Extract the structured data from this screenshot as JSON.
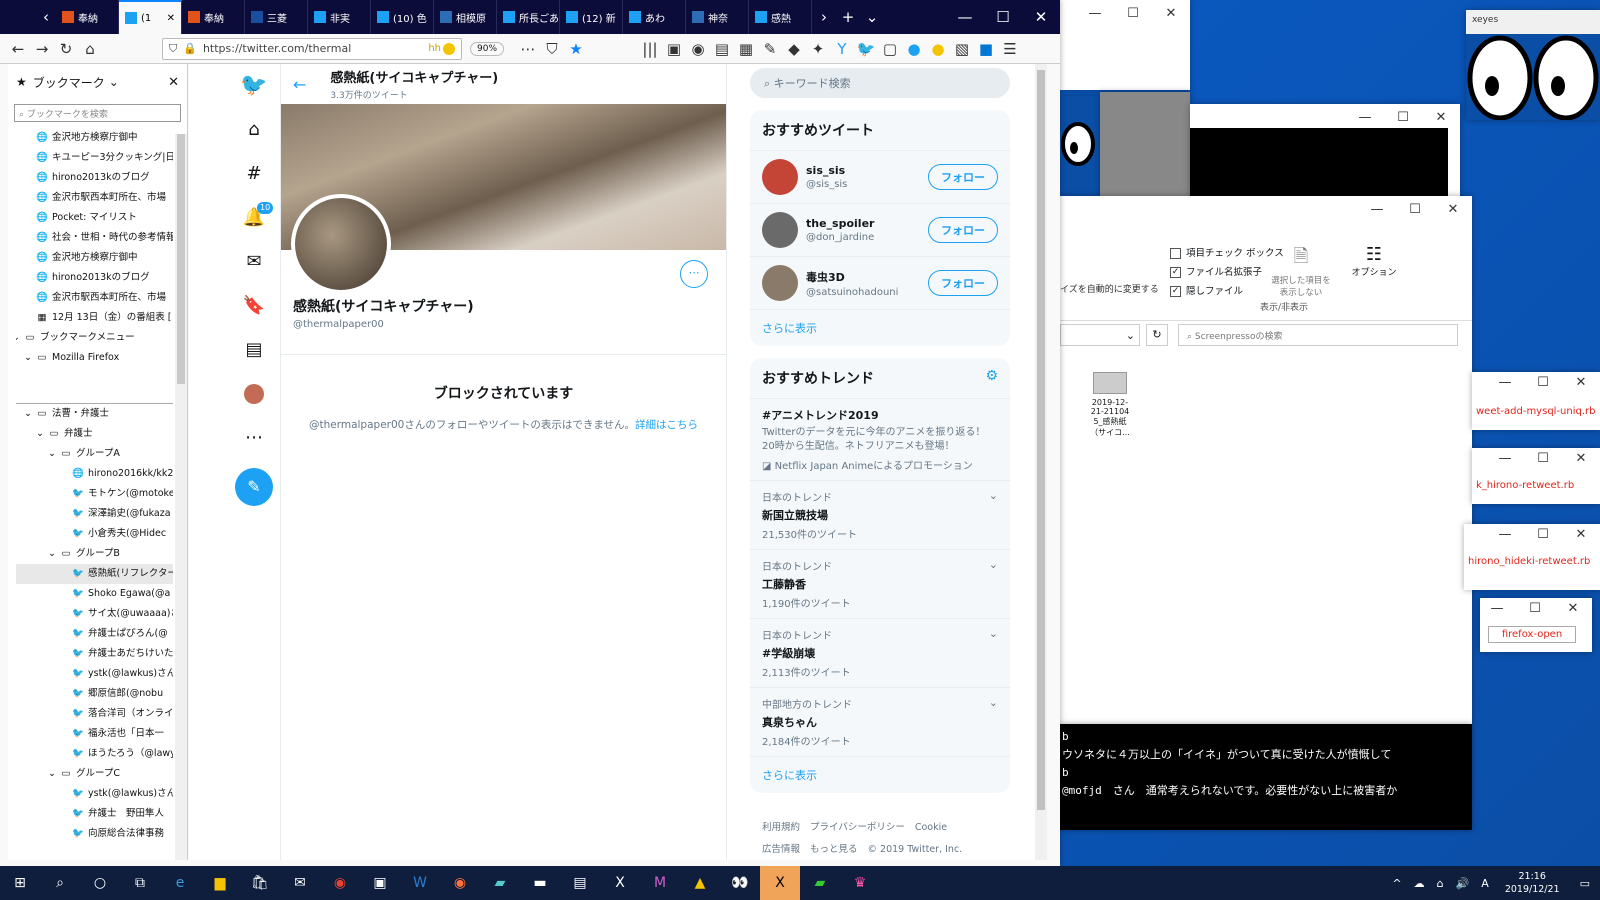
{
  "tabs": [
    {
      "label": "奉納"
    },
    {
      "label": "(1"
    },
    {
      "label": "奉納"
    },
    {
      "label": "三菱"
    },
    {
      "label": "非実"
    },
    {
      "label": "(10) 色"
    },
    {
      "label": "相模原"
    },
    {
      "label": "所長ごあい"
    },
    {
      "label": "(12) 新"
    },
    {
      "label": "あわ"
    },
    {
      "label": "神奈"
    },
    {
      "label": "感熱"
    }
  ],
  "navbar": {
    "url": "https://twitter.com/thermal",
    "ext_text": "hh",
    "zoom": "90%"
  },
  "bookmarks": {
    "title": "ブックマーク",
    "search_placeholder": "ブックマークを検索",
    "items": [
      {
        "label": "金沢地方検察庁御中",
        "indent": 0,
        "icon": "globe"
      },
      {
        "label": "キユーピー3分クッキング|日付別",
        "indent": 0,
        "icon": "globe"
      },
      {
        "label": "hirono2013kのブログ",
        "indent": 0,
        "icon": "globe"
      },
      {
        "label": "金沢市駅西本町所在、市場",
        "indent": 0,
        "icon": "globe"
      },
      {
        "label": "Pocket: マイリスト",
        "indent": 0,
        "icon": "globe"
      },
      {
        "label": "社会・世相・時代の参考情報",
        "indent": 0,
        "icon": "globe"
      },
      {
        "label": "金沢地方検察庁御中",
        "indent": 0,
        "icon": "globe"
      },
      {
        "label": "hirono2013kのブログ",
        "indent": 0,
        "icon": "globe"
      },
      {
        "label": "金沢市駅西本町所在、市場",
        "indent": 0,
        "icon": "globe"
      },
      {
        "label": "12月 13日（金）の番組表 [",
        "indent": 0,
        "icon": "grid"
      },
      {
        "label": "ブックマークメニュー",
        "indent": -1,
        "icon": "folder"
      },
      {
        "label": "Mozilla Firefox",
        "indent": 0,
        "icon": "folder"
      },
      {
        "label": "",
        "indent": 0,
        "icon": "none"
      },
      {
        "label": "",
        "indent": 0,
        "icon": "none"
      },
      {
        "label": "法曹・弁護士",
        "indent": 0,
        "icon": "folder"
      },
      {
        "label": "弁護士",
        "indent": 1,
        "icon": "folder"
      },
      {
        "label": "グループA",
        "indent": 2,
        "icon": "folder"
      },
      {
        "label": "hirono2016kk/kk2",
        "indent": 3,
        "icon": "globe"
      },
      {
        "label": "モトケン(@motoken",
        "indent": 3,
        "icon": "bird"
      },
      {
        "label": "深澤諭史(@fukaza",
        "indent": 3,
        "icon": "bird"
      },
      {
        "label": "小倉秀夫(@Hidec",
        "indent": 3,
        "icon": "bird"
      },
      {
        "label": "グループB",
        "indent": 2,
        "icon": "folder"
      },
      {
        "label": "感熱紙(リフレクター",
        "indent": 3,
        "icon": "bird"
      },
      {
        "label": "Shoko Egawa(@a",
        "indent": 3,
        "icon": "bird"
      },
      {
        "label": "サイ太(@uwaaaa)さ",
        "indent": 3,
        "icon": "bird"
      },
      {
        "label": "弁護士ぱぴろん(@",
        "indent": 3,
        "icon": "bird"
      },
      {
        "label": "弁護士あだちけいた",
        "indent": 3,
        "icon": "bird"
      },
      {
        "label": "ystk(@lawkus)さん",
        "indent": 3,
        "icon": "bird"
      },
      {
        "label": "郷原信郎(@nobu",
        "indent": 3,
        "icon": "bird"
      },
      {
        "label": "落合洋司（オンライ",
        "indent": 3,
        "icon": "bird"
      },
      {
        "label": "福永活也「日本一",
        "indent": 3,
        "icon": "bird"
      },
      {
        "label": "ほうたろう（@lawy",
        "indent": 3,
        "icon": "bird"
      },
      {
        "label": "グループC",
        "indent": 2,
        "icon": "folder"
      },
      {
        "label": "ystk(@lawkus)さん",
        "indent": 3,
        "icon": "bird"
      },
      {
        "label": "弁護士　野田隼人",
        "indent": 3,
        "icon": "bird"
      },
      {
        "label": "向原総合法律事務",
        "indent": 3,
        "icon": "bird"
      }
    ]
  },
  "twitter": {
    "notif_count": "10",
    "header_name": "感熱紙(サイコキャプチャー)",
    "header_count": "3.3万件のツイート",
    "profile_name": "感熱紙(サイコキャプチャー)",
    "profile_handle": "@thermalpaper00",
    "blocked_title": "ブロックされています",
    "blocked_text": "@thermalpaper00さんのフォローやツイートの表示はできません。",
    "blocked_link": "詳細はこちら",
    "search_placeholder": "キーワード検索",
    "who_title": "おすすめツイート",
    "follow_label": "フォロー",
    "users": [
      {
        "name": "sis_sis",
        "handle": "@sis_sis",
        "color": "#c44536"
      },
      {
        "name": "the_spoiler",
        "handle": "@don_jardine",
        "color": "#6a6a6a"
      },
      {
        "name": "毒虫3D",
        "handle": "@satsuinohadouni",
        "color": "#8a7a6a"
      }
    ],
    "show_more": "さらに表示",
    "trends_title": "おすすめトレンド",
    "promo": {
      "name": "#アニメトレンド2019",
      "desc": "Twitterのデータを元に今年のアニメを振り返る！20時から生配信。ネトフリアニメも登場！",
      "by": "Netflix Japan Animeによるプロモーション"
    },
    "trends": [
      {
        "cat": "日本のトレンド",
        "name": "新国立競技場",
        "count": "21,530件のツイート"
      },
      {
        "cat": "日本のトレンド",
        "name": "工藤静香",
        "count": "1,190件のツイート"
      },
      {
        "cat": "日本のトレンド",
        "name": "#学級崩壊",
        "count": "2,113件のツイート"
      },
      {
        "cat": "中部地方のトレンド",
        "name": "真泉ちゃん",
        "count": "2,184件のツイート"
      }
    ],
    "footer": [
      "利用規約",
      "プライバシーポリシー",
      "Cookie",
      "広告情報",
      "もっと見る",
      "© 2019 Twitter, Inc."
    ]
  },
  "explorer": {
    "checks": [
      {
        "label": "項目チェック ボックス",
        "checked": false
      },
      {
        "label": "ファイル名拡張子",
        "checked": true
      },
      {
        "label": "隠しファイル",
        "checked": true
      }
    ],
    "hide_label": "選択した項目を表示しない",
    "options_label": "オプション",
    "group_label": "表示/非表示",
    "left_label": "イズを自動的に変更する",
    "search_placeholder": "Screenpressoの検索",
    "file_label": "2019-12-21-21104 5_感熱紙（サイコ..."
  },
  "xeyes_title": "xeyes",
  "small_windows": [
    {
      "label": "weet-add-mysql-uniq.rb"
    },
    {
      "label": "k_hirono-retweet.rb"
    },
    {
      "label": "hirono_hideki-retweet.rb"
    },
    {
      "label": "firefox-open"
    }
  ],
  "terminal": {
    "line1": "b",
    "line2": "ウソネタに４万以上の「イイネ」がついて真に受けた人が憤慨して",
    "line3": "b",
    "line4": "@mofjd　さん　通常考えられないです。必要性がない上に被害者か"
  },
  "clock": {
    "time": "21:16",
    "date": "2019/12/21"
  }
}
